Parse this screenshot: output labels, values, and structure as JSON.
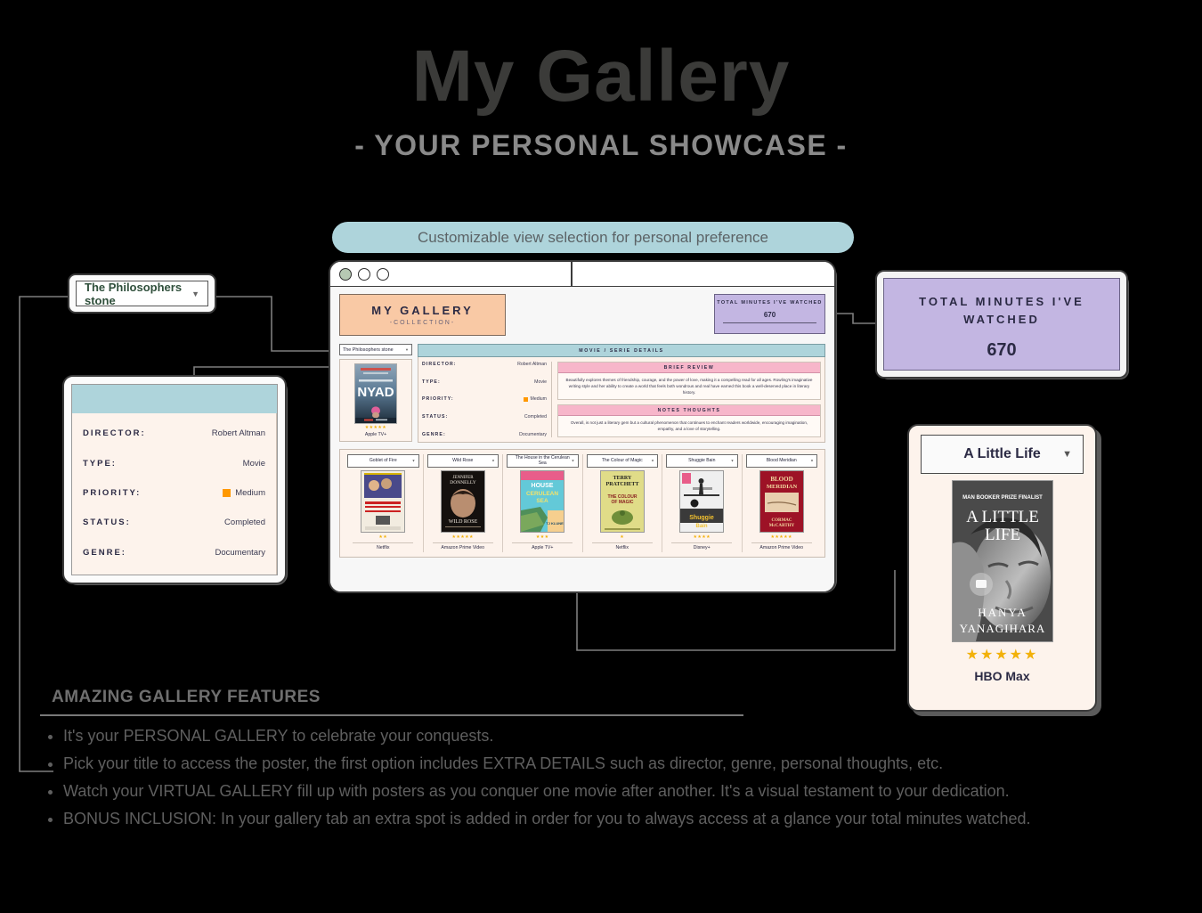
{
  "header": {
    "title": "My Gallery",
    "subtitle": "- YOUR PERSONAL SHOWCASE -"
  },
  "banner": {
    "text": "Customizable view selection for personal preference"
  },
  "app_window": {
    "brand": {
      "name": "MY GALLERY",
      "tagline": "-COLLECTION-"
    },
    "minutes_widget": {
      "label": "TOTAL MINUTES I'VE WATCHED",
      "value": "670"
    },
    "selector": {
      "value": "The Philosophers stone"
    },
    "featured": {
      "poster_title": "NYAD",
      "stars": "★★★★★",
      "provider": "Apple TV+"
    },
    "details_header": "MOVIE / SERIE DETAILS",
    "fields": [
      {
        "label": "DIRECTOR:",
        "value": "Robert Altman"
      },
      {
        "label": "TYPE:",
        "value": "Movie"
      },
      {
        "label": "PRIORITY:",
        "value": "Medium",
        "swatch": "#ff9800"
      },
      {
        "label": "STATUS:",
        "value": "Completed"
      },
      {
        "label": "GENRE:",
        "value": "Documentary"
      }
    ],
    "review": {
      "heading": "BRIEF REVIEW",
      "text": "Beautifully explores themes of friendship, courage, and the power of love, making it a compelling read for all ages. Rowling's imaginative writing style and her ability to create a world that feels both wondrous and real have earned this book a well-deserved place in literary history."
    },
    "notes": {
      "heading": "NOTES THOUGHTS",
      "text": "Overall, is not just a literary gem but a cultural phenomenon that continues to enchant readers worldwide, encouraging imagination, empathy, and a love of storytelling."
    },
    "gallery": [
      {
        "title": "Goblet of Fire",
        "stars": "★★",
        "provider": "Netflix"
      },
      {
        "title": "Wild Rose",
        "stars": "★★★★★",
        "provider": "Amazon Prime Video"
      },
      {
        "title": "The House in the Cerulean Sea",
        "stars": "★★★",
        "provider": "Apple TV+"
      },
      {
        "title": "The Colour of Magic",
        "stars": "★",
        "provider": "Netflix"
      },
      {
        "title": "Shuggie Bain",
        "stars": "★★★★",
        "provider": "Disney+"
      },
      {
        "title": "Blood Meridian",
        "stars": "★★★★★",
        "provider": "Amazon Prime Video"
      }
    ]
  },
  "callouts": {
    "dropdown": {
      "value": "The Philosophers stone"
    },
    "details_card": {
      "fields": [
        {
          "label": "DIRECTOR:",
          "value": "Robert Altman"
        },
        {
          "label": "TYPE:",
          "value": "Movie"
        },
        {
          "label": "PRIORITY:",
          "value": "Medium",
          "swatch": "#ff9800"
        },
        {
          "label": "STATUS:",
          "value": "Completed"
        },
        {
          "label": "GENRE:",
          "value": "Documentary"
        }
      ]
    },
    "minutes": {
      "label": "TOTAL MINUTES I'VE WATCHED",
      "value": "670"
    },
    "little_life": {
      "title": "A Little Life",
      "poster_badge": "MAN BOOKER PRIZE FINALIST",
      "poster_title": "A LITTLE LIFE",
      "poster_author": "HANYA YANAGIHARA",
      "stars": "★★★★★",
      "provider": "HBO Max"
    }
  },
  "features": {
    "title": "AMAZING GALLERY FEATURES",
    "items": [
      "It's your PERSONAL GALLERY to celebrate your conquests.",
      "Pick your title to access the poster, the first option includes EXTRA DETAILS such as director, genre, personal thoughts, etc.",
      "Watch your VIRTUAL GALLERY fill up with posters as you conquer one movie after another. It's a visual testament to your dedication.",
      "BONUS INCLUSION: In your gallery tab an extra spot is added in order for you to always access at a glance your total minutes watched."
    ]
  },
  "colors": {
    "title": "#3b3b39",
    "banner": "#aed4db",
    "brand": "#f9c9a5",
    "purple": "#c3b6e2",
    "pink": "#f7b6ca",
    "cream": "#fdf3ec",
    "priority": "#ff9800",
    "star": "#f2b10a"
  }
}
